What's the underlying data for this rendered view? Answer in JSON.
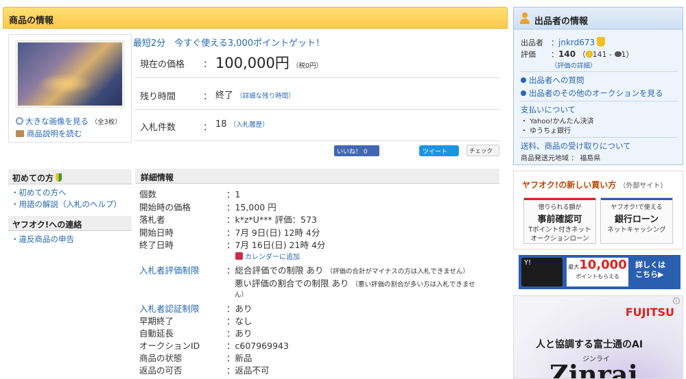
{
  "main": {
    "header_title": "商品の情報",
    "promo": "最短2分　今すぐ使える3,000ポイントゲット！",
    "thumb_link_large": "大きな画像を見る",
    "thumb_count": "（全3枚）",
    "thumb_link_desc": "商品説明を読む",
    "price": {
      "label": "現在の価格",
      "colon": "：",
      "value": "100,000円",
      "tax": "（税0円）"
    },
    "remaining": {
      "label": "残り時間",
      "colon": "：",
      "value": "終了",
      "link": "（詳細な残り時間）"
    },
    "bids": {
      "label": "入札件数",
      "colon": "：",
      "value": "18",
      "link": "（入札履歴）"
    },
    "social": {
      "like": "いいね！ 0",
      "tweet": "ツイート",
      "check": "チェック"
    }
  },
  "nav": {
    "beginner_head": "初めての方",
    "beginner_items": [
      "・初めての方へ",
      "・用語の解説（入札のヘルプ）"
    ],
    "contact_head": "ヤフオク!への連絡",
    "contact_items": [
      "・違反商品の申告"
    ]
  },
  "details": {
    "head": "詳細情報",
    "rows": [
      {
        "label": "個数",
        "value": "：1"
      },
      {
        "label": "開始時の価格",
        "value": "：15,000 円"
      },
      {
        "label": "落札者",
        "value": "：k*z*U*** 評価：573"
      },
      {
        "label": "開始日時",
        "value": "：7月 9日(日) 12時 4分"
      },
      {
        "label": "終了日時",
        "value": "：7月 16日(日) 21時 4分"
      }
    ],
    "calendar": "カレンダーに追加",
    "bidder_rating_label": "入札者評価制限",
    "bidder_rating_v1": "：総合評価での制限 あり",
    "bidder_rating_n1": "（評価の合計がマイナスの方は入札できません）",
    "bidder_rating_v2": "悪い評価の割合での制限 あり",
    "bidder_rating_n2a": "（悪い評価の割合が多い方は入札できませ",
    "bidder_rating_n2b": "ん）",
    "auth_label": "入札者認証制限",
    "auth_value": "：あり",
    "rows2": [
      {
        "label": "早期終了",
        "value": "：なし"
      },
      {
        "label": "自動延長",
        "value": "：あり"
      },
      {
        "label": "オークションID",
        "value": "：c607969943"
      },
      {
        "label": "商品の状態",
        "value": "：新品"
      },
      {
        "label": "返品の可否",
        "value": "：返品不可"
      }
    ]
  },
  "seller": {
    "head": "出品者の情報",
    "seller_label": "出品者　：",
    "seller_name": "jnkrd673",
    "rating_label": "評価　　：",
    "rating_value": "140",
    "rating_good": "141",
    "rating_bad": "1",
    "rating_open": "（",
    "rating_dash": " - ",
    "rating_close": "）",
    "rating_link": "（評価の詳細）",
    "question_link": "出品者への質問",
    "other_link": "出品者のその他のオークションを見る",
    "payment_link": "支払いについて",
    "payment_items": [
      "・ Yahoo!かんたん決済",
      "・ ゆうちょ銀行"
    ],
    "shipping_link": "送料、商品の受け取りについて",
    "origin": "商品発送元地域 ： 福島県"
  },
  "new_buy": {
    "title": "ヤフオク!の新しい買い方",
    "sub": "（外部サイト）",
    "card1": {
      "l1": "借りられる額が",
      "l2": "事前確認可",
      "l3a": "Tポイント付きネット",
      "l3b": "オークションローン"
    },
    "card2": {
      "l1": "ヤフオク!で使える",
      "l2": "銀行ローン",
      "l3a": "ネットキャッシング",
      "l3b": ""
    }
  },
  "ads": {
    "banner1_card": "Y!",
    "banner1_top": "最大",
    "banner1_big": "10,000",
    "banner1_small": "ポイントもらえる",
    "banner1_right_a": "詳しくは",
    "banner1_right_b": "こちら▶",
    "banner2_brand": "FUJITSU",
    "banner2_text": "人と協調する富士通のAI",
    "banner2_sub": "ジンライ",
    "banner2_big": "Zinrai",
    "banner2_info": "i"
  },
  "colors": {
    "header_bg": "#ffd35c",
    "link": "#2667b2",
    "seller_bg": "#eef4fc",
    "card1_bar": "#e0201a",
    "card2_bar": "#2a5fb0"
  }
}
